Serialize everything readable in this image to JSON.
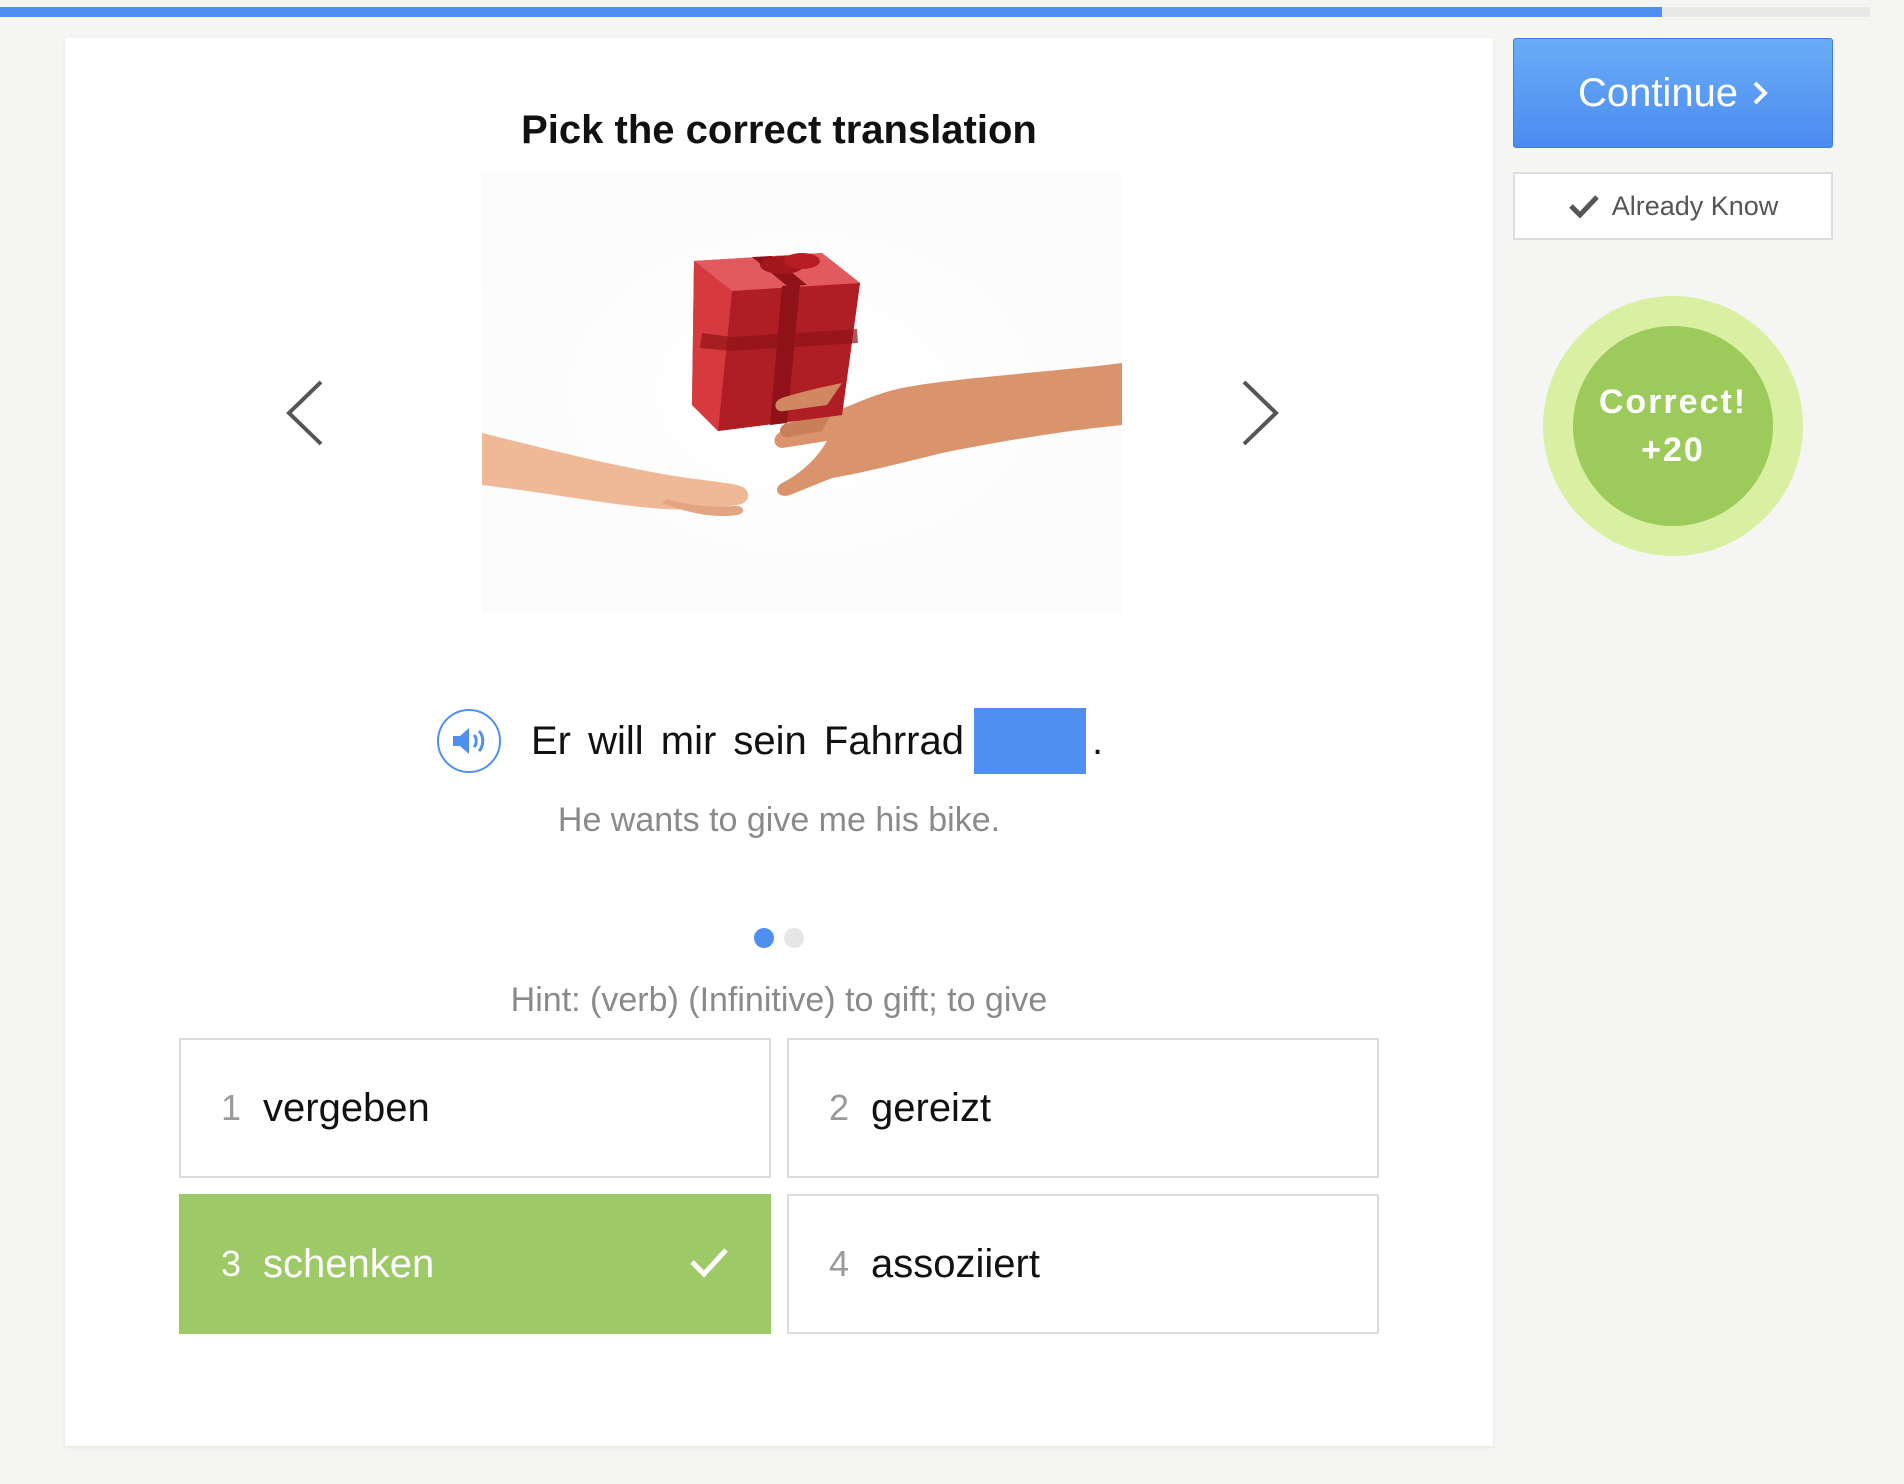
{
  "progress": {
    "fraction": 0.889
  },
  "exercise": {
    "title": "Pick the correct translation",
    "sentence": "Er will mir sein Fahrrad",
    "sentence_end": ".",
    "translation": "He wants to give me his bike.",
    "hint": "Hint: (verb) (Infinitive) to gift; to give",
    "dots": {
      "total": 2,
      "active": 1
    }
  },
  "options": [
    {
      "num": "1",
      "word": "vergeben"
    },
    {
      "num": "2",
      "word": "gereizt"
    },
    {
      "num": "3",
      "word": "schenken",
      "correct": true
    },
    {
      "num": "4",
      "word": "assoziiert"
    }
  ],
  "sidebar": {
    "continue_label": "Continue",
    "already_know_label": "Already Know",
    "badge_line1": "Correct!",
    "badge_line2": "+20"
  },
  "colors": {
    "accent_blue": "#4f8ff0",
    "correct_green": "#9dc967",
    "badge_outer": "#d9f0a3",
    "badge_inner": "#9ccb5c"
  },
  "icons": [
    "chevron-left-icon",
    "chevron-right-icon",
    "speaker-icon",
    "checkmark-icon",
    "chevron-right-small-icon",
    "gift-image"
  ]
}
